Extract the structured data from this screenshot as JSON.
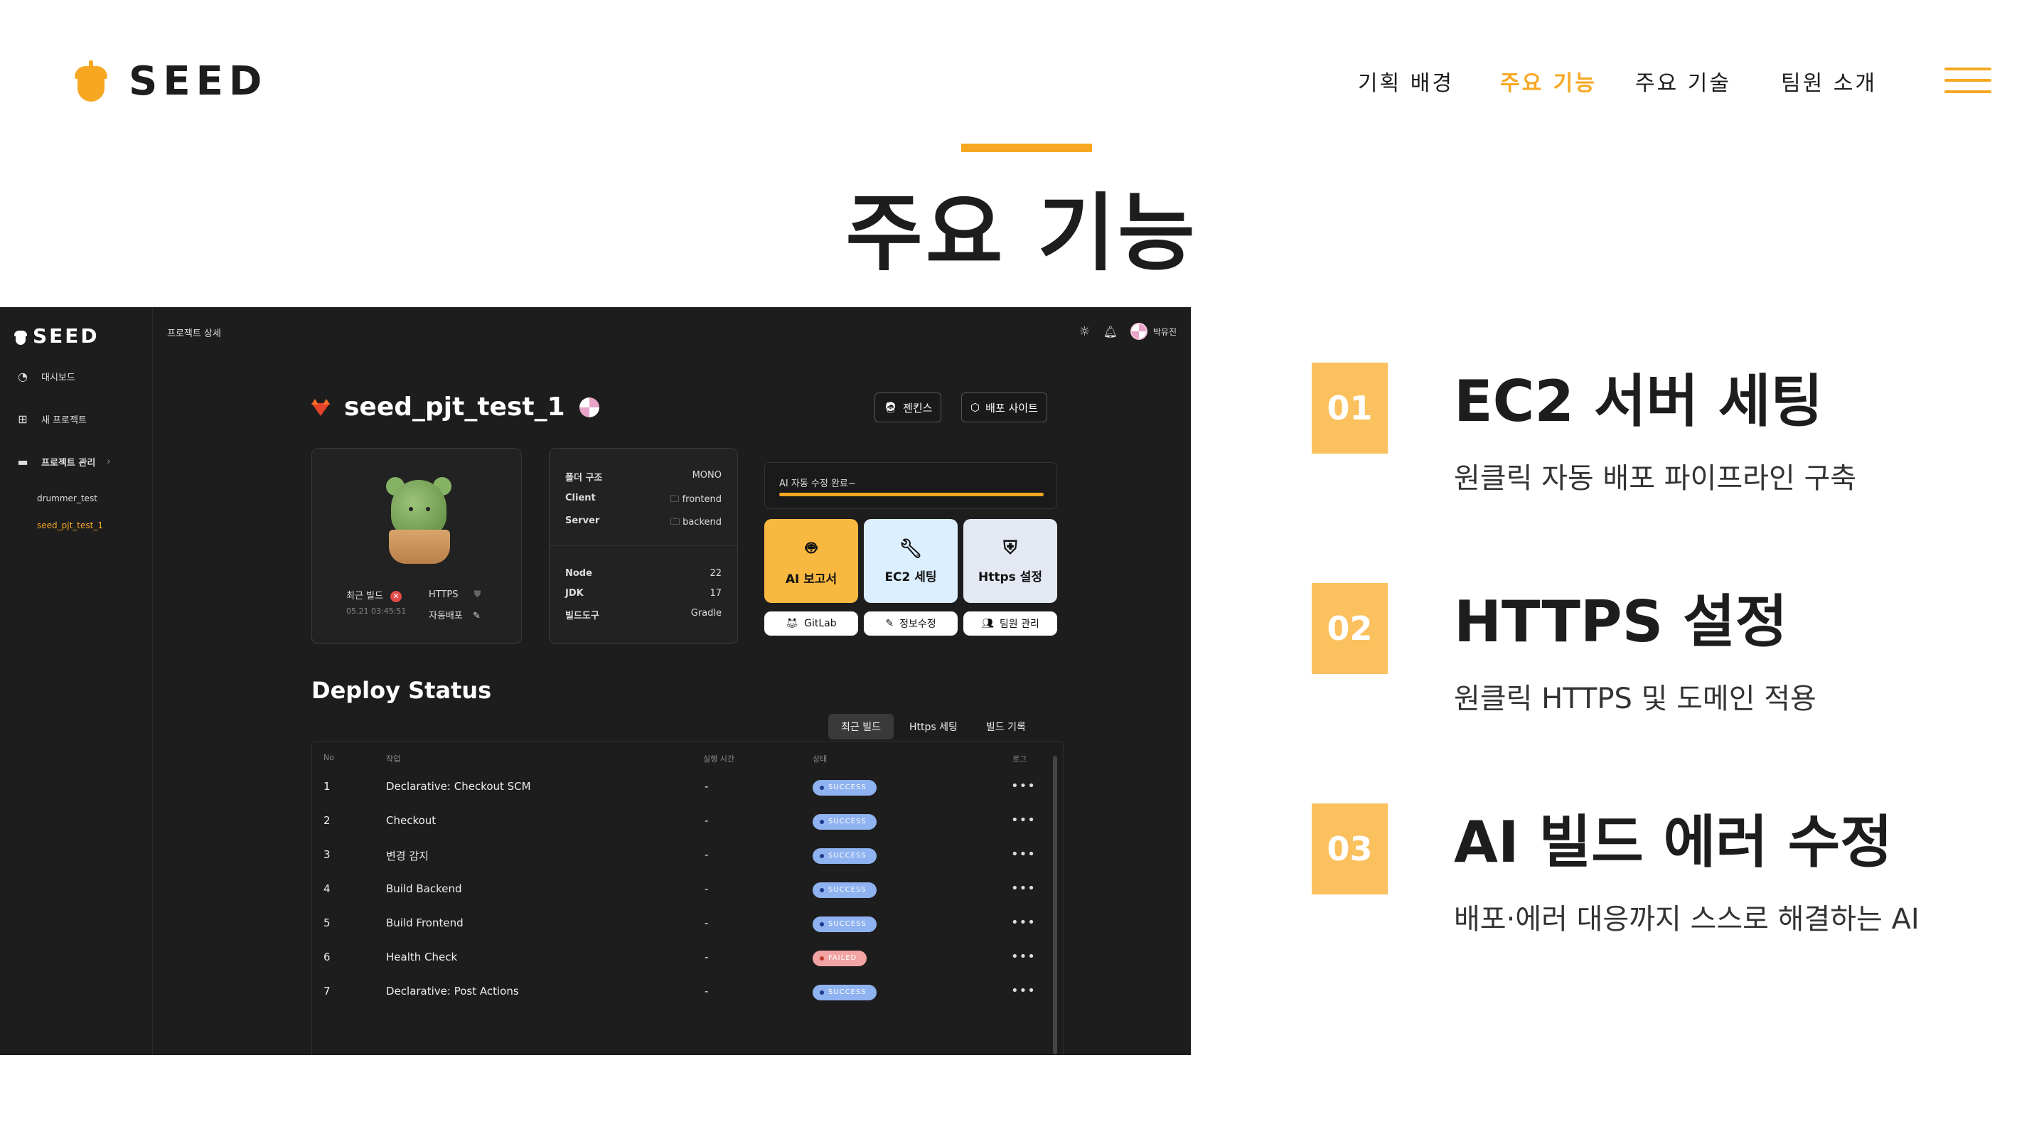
{
  "header": {
    "logo_text": "SEED",
    "nav": [
      {
        "label": "기획 배경",
        "active": false
      },
      {
        "label": "주요 기능",
        "active": true
      },
      {
        "label": "주요 기술",
        "active": false
      },
      {
        "label": "팀원 소개",
        "active": false
      }
    ],
    "accent_color": "#f7a823"
  },
  "page_title": "주요 기능",
  "app": {
    "sidebar": {
      "logo_text": "SEED",
      "items": [
        {
          "label": "대시보드",
          "icon": "dashboard-icon"
        },
        {
          "label": "새 프로젝트",
          "icon": "new-folder-icon"
        },
        {
          "label": "프로젝트 관리",
          "icon": "folder-icon"
        }
      ],
      "projects": [
        "drummer_test",
        "seed_pjt_test_1"
      ]
    },
    "topbar": {
      "title": "프로젝트 상세",
      "user": "박유진"
    },
    "project": {
      "name": "seed_pjt_test_1",
      "buttons": [
        {
          "label": "젠킨스",
          "icon": "jenkins-icon"
        },
        {
          "label": "배포 사이트",
          "icon": "cube-icon"
        }
      ]
    },
    "status_card": {
      "recent_build_label": "최근 빌드",
      "recent_build_time": "05.21 03:45:51",
      "https_label": "HTTPS",
      "auto_deploy_label": "자동배포"
    },
    "info_card": {
      "rows_top": [
        {
          "key": "폴더 구조",
          "value": "MONO"
        },
        {
          "key": "Client",
          "value": "frontend"
        },
        {
          "key": "Server",
          "value": "backend"
        }
      ],
      "rows_bottom": [
        {
          "key": "Node",
          "value": "22"
        },
        {
          "key": "JDK",
          "value": "17"
        },
        {
          "key": "빌드도구",
          "value": "Gradle"
        }
      ]
    },
    "ai_panel": {
      "text": "AI 자동 수정 완료~",
      "progress": 1.0
    },
    "features": [
      {
        "label": "AI 보고서",
        "icon": "ai-report-icon",
        "color": "#f9b940"
      },
      {
        "label": "EC2 세팅",
        "icon": "wrench-icon",
        "color": "#dcefff"
      },
      {
        "label": "Https 설정",
        "icon": "shield-icon",
        "color": "#e4e8f3"
      }
    ],
    "small_buttons": [
      {
        "label": "GitLab",
        "icon": "gitlab-icon"
      },
      {
        "label": "정보수정",
        "icon": "pencil-icon"
      },
      {
        "label": "팀원 관리",
        "icon": "users-icon"
      }
    ],
    "deploy": {
      "title": "Deploy Status",
      "tabs": [
        "최근 빌드",
        "Https 세팅",
        "빌드 기록"
      ],
      "columns": [
        "No",
        "작업",
        "실행 시간",
        "상태",
        "로그"
      ],
      "rows": [
        {
          "no": "1",
          "task": "Declarative: Checkout SCM",
          "time": "-",
          "status": "SUCCESS"
        },
        {
          "no": "2",
          "task": "Checkout",
          "time": "-",
          "status": "SUCCESS"
        },
        {
          "no": "3",
          "task": "변경 감지",
          "time": "-",
          "status": "SUCCESS"
        },
        {
          "no": "4",
          "task": "Build Backend",
          "time": "-",
          "status": "SUCCESS"
        },
        {
          "no": "5",
          "task": "Build Frontend",
          "time": "-",
          "status": "SUCCESS"
        },
        {
          "no": "6",
          "task": "Health Check",
          "time": "-",
          "status": "FAILED"
        },
        {
          "no": "7",
          "task": "Declarative: Post Actions",
          "time": "-",
          "status": "SUCCESS"
        }
      ]
    }
  },
  "feature_list": [
    {
      "num": "01",
      "title": "EC2 서버 세팅",
      "desc": "원클릭 자동 배포 파이프라인 구축"
    },
    {
      "num": "02",
      "title": "HTTPS 설정",
      "desc": "원클릭 HTTPS 및 도메인 적용"
    },
    {
      "num": "03",
      "title": "AI 빌드 에러 수정",
      "desc": "배포·에러 대응까지 스스로 해결하는 AI"
    }
  ]
}
